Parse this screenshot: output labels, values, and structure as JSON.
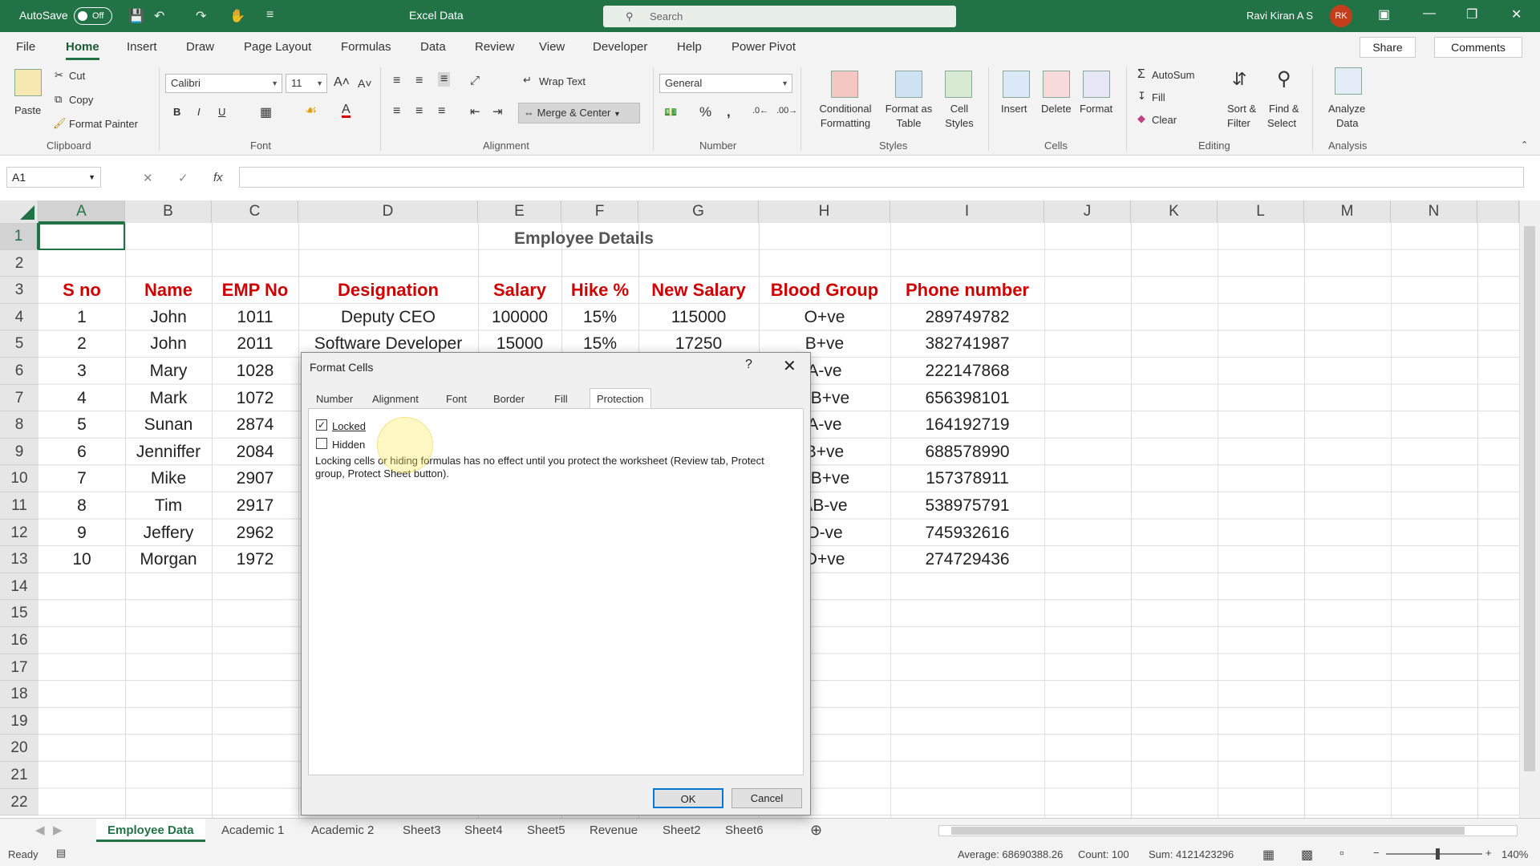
{
  "titlebar": {
    "autosave_label": "AutoSave",
    "autosave_state": "Off",
    "doc_title": "Excel Data",
    "search_placeholder": "Search",
    "user_name": "Ravi Kiran A S",
    "user_initials": "RK"
  },
  "menu": {
    "items": [
      "File",
      "Home",
      "Insert",
      "Draw",
      "Page Layout",
      "Formulas",
      "Data",
      "Review",
      "View",
      "Developer",
      "Help",
      "Power Pivot"
    ],
    "active": "Home",
    "share": "Share",
    "comments": "Comments"
  },
  "ribbon": {
    "clipboard": {
      "paste": "Paste",
      "cut": "Cut",
      "copy": "Copy",
      "format_painter": "Format Painter",
      "label": "Clipboard"
    },
    "font": {
      "name": "Calibri",
      "size": "11",
      "label": "Font"
    },
    "alignment": {
      "wrap_text": "Wrap Text",
      "merge_center": "Merge & Center",
      "label": "Alignment"
    },
    "number": {
      "format": "General",
      "label": "Number"
    },
    "styles": {
      "conditional_1": "Conditional",
      "conditional_2": "Formatting",
      "format_table_1": "Format as",
      "format_table_2": "Table",
      "cell_styles_1": "Cell",
      "cell_styles_2": "Styles",
      "label": "Styles"
    },
    "cells": {
      "insert": "Insert",
      "delete": "Delete",
      "format": "Format",
      "label": "Cells"
    },
    "editing": {
      "autosum": "AutoSum",
      "fill": "Fill",
      "clear": "Clear",
      "sort_1": "Sort &",
      "sort_2": "Filter",
      "find_1": "Find &",
      "find_2": "Select",
      "label": "Editing"
    },
    "analysis": {
      "analyze_1": "Analyze",
      "analyze_2": "Data",
      "label": "Analysis"
    }
  },
  "formula_bar": {
    "name_box": "A1",
    "fx": "fx",
    "value": ""
  },
  "sheet": {
    "columns": [
      "A",
      "B",
      "C",
      "D",
      "E",
      "F",
      "G",
      "H",
      "I",
      "J",
      "K",
      "L",
      "M",
      "N"
    ],
    "rows": [
      "1",
      "2",
      "3",
      "4",
      "5",
      "6",
      "7",
      "8",
      "9",
      "10",
      "11",
      "12",
      "13",
      "14",
      "15",
      "16",
      "17",
      "18",
      "19",
      "20",
      "21",
      "22"
    ],
    "title": "Employee Details",
    "headers": [
      "S no",
      "Name",
      "EMP No",
      "Designation",
      "Salary",
      "Hike %",
      "New Salary",
      "Blood Group",
      "Phone number"
    ],
    "data_rows": [
      [
        "1",
        "John",
        "1011",
        "Deputy CEO",
        "100000",
        "15%",
        "115000",
        "O+ve",
        "289749782"
      ],
      [
        "2",
        "John",
        "2011",
        "Software Developer",
        "15000",
        "15%",
        "17250",
        "B+ve",
        "382741987"
      ],
      [
        "3",
        "Mary",
        "1028",
        "",
        "",
        "",
        "",
        "A-ve",
        "222147868"
      ],
      [
        "4",
        "Mark",
        "1072",
        "",
        "",
        "",
        "",
        "AB+ve",
        "656398101"
      ],
      [
        "5",
        "Sunan",
        "2874",
        "",
        "",
        "",
        "",
        "A-ve",
        "164192719"
      ],
      [
        "6",
        "Jenniffer",
        "2084",
        "",
        "",
        "",
        "",
        "B+ve",
        "688578990"
      ],
      [
        "7",
        "Mike",
        "2907",
        "",
        "",
        "",
        "",
        "AB+ve",
        "157378911"
      ],
      [
        "8",
        "Tim",
        "2917",
        "",
        "",
        "",
        "",
        "AB-ve",
        "538975791"
      ],
      [
        "9",
        "Jeffery",
        "2962",
        "",
        "",
        "",
        "",
        "O-ve",
        "745932616"
      ],
      [
        "10",
        "Morgan",
        "1972",
        "",
        "",
        "",
        "",
        "O+ve",
        "274729436"
      ]
    ]
  },
  "tabs": {
    "items": [
      "Employee Data",
      "Academic 1",
      "Academic 2",
      "Sheet3",
      "Sheet4",
      "Sheet5",
      "Revenue",
      "Sheet2",
      "Sheet6"
    ],
    "active": "Employee Data"
  },
  "status": {
    "ready": "Ready",
    "average": "Average: 68690388.26",
    "count": "Count: 100",
    "sum": "Sum: 4121423296",
    "zoom": "140%"
  },
  "dialog": {
    "title": "Format Cells",
    "help": "?",
    "tabs": [
      "Number",
      "Alignment",
      "Font",
      "Border",
      "Fill",
      "Protection"
    ],
    "active_tab": "Protection",
    "locked_label": "Locked",
    "locked_checked": true,
    "hidden_label": "Hidden",
    "hidden_checked": false,
    "note": "Locking cells or hiding formulas has no effect until you protect the worksheet (Review tab, Protect group, Protect Sheet button).",
    "ok": "OK",
    "cancel": "Cancel"
  },
  "colors": {
    "accent": "#217346",
    "header_red": "#d00000",
    "dialog_focus": "#0078d7"
  }
}
